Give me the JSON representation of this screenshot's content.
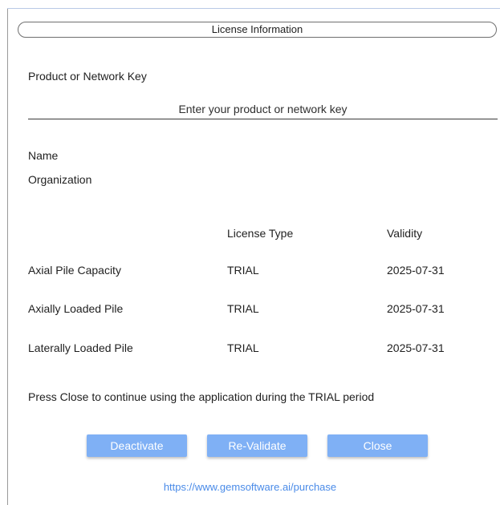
{
  "dialog": {
    "title": "License Information"
  },
  "key_section": {
    "label": "Product or Network Key",
    "placeholder": "Enter your product or network key",
    "value": ""
  },
  "user": {
    "name_label": "Name",
    "organization_label": "Organization"
  },
  "license_table": {
    "headers": {
      "product": "",
      "license_type": "License Type",
      "validity": "Validity"
    },
    "rows": [
      {
        "product": "Axial Pile Capacity",
        "license_type": "TRIAL",
        "validity": "2025-07-31"
      },
      {
        "product": "Axially Loaded Pile",
        "license_type": "TRIAL",
        "validity": "2025-07-31"
      },
      {
        "product": "Laterally Loaded Pile",
        "license_type": "TRIAL",
        "validity": "2025-07-31"
      }
    ]
  },
  "message": "Press Close to continue using the application during the TRIAL period",
  "buttons": {
    "deactivate": "Deactivate",
    "revalidate": "Re-Validate",
    "close": "Close"
  },
  "purchase_link": "https://www.gemsoftware.ai/purchase",
  "colors": {
    "button_bg": "#7fb0f5",
    "button_text": "#ffffff",
    "link": "#4a8be8"
  }
}
